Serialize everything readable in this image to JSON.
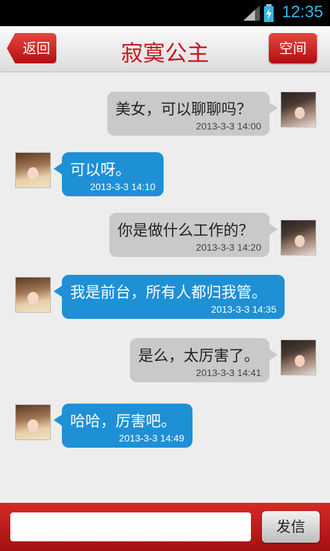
{
  "status_bar": {
    "time": "12:35"
  },
  "header": {
    "back_label": "返回",
    "title": "寂寞公主",
    "space_label": "空间"
  },
  "messages": [
    {
      "side": "right",
      "text": "美女，可以聊聊吗？",
      "time": "2013-3-3 14:00"
    },
    {
      "side": "left",
      "text": "可以呀。",
      "time": "2013-3-3 14:10"
    },
    {
      "side": "right",
      "text": "你是做什么工作的？",
      "time": "2013-3-3 14:20"
    },
    {
      "side": "left",
      "text": "我是前台，所有人都归我管。",
      "time": "2013-3-3 14:35"
    },
    {
      "side": "right",
      "text": "是么，太厉害了。",
      "time": "2013-3-3 14:41"
    },
    {
      "side": "left",
      "text": "哈哈，厉害吧。",
      "time": "2013-3-3 14:49"
    }
  ],
  "composer": {
    "input_value": "",
    "send_label": "发信"
  },
  "colors": {
    "accent_red": "#c8161d",
    "bubble_blue": "#1e90d6",
    "bubble_grey": "#c9c9c9"
  }
}
